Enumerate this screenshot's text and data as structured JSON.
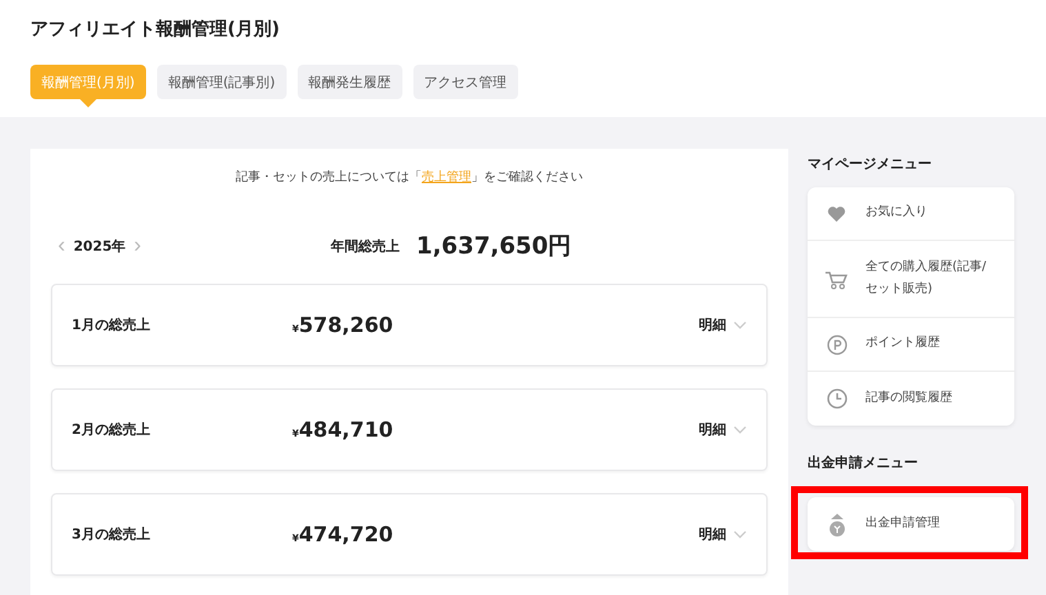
{
  "page_title": "アフィリエイト報酬管理(月別)",
  "tabs": [
    {
      "label": "報酬管理(月別)",
      "selected": true
    },
    {
      "label": "報酬管理(記事別)",
      "selected": false
    },
    {
      "label": "報酬発生履歴",
      "selected": false
    },
    {
      "label": "アクセス管理",
      "selected": false
    }
  ],
  "notice": {
    "before": "記事・セットの売上については「",
    "link": "売上管理",
    "after": "」をご確認ください"
  },
  "year_nav": {
    "prev": "‹",
    "year": "2025年",
    "next": "›"
  },
  "annual_total": {
    "label": "年間総売上",
    "value": "1,637,650円"
  },
  "months": [
    {
      "label": "1月の総売上",
      "currency": "¥",
      "amount": "578,260",
      "detail": "明細"
    },
    {
      "label": "2月の総売上",
      "currency": "¥",
      "amount": "484,710",
      "detail": "明細"
    },
    {
      "label": "3月の総売上",
      "currency": "¥",
      "amount": "474,720",
      "detail": "明細"
    }
  ],
  "mypage_menu": {
    "title": "マイページメニュー",
    "items": [
      {
        "kind": "heart",
        "label": "お気に入り"
      },
      {
        "kind": "cart",
        "label": "全ての購入履歴(記事/セット販売)"
      },
      {
        "kind": "point",
        "label": "ポイント履歴"
      },
      {
        "kind": "clock",
        "label": "記事の閲覧履歴"
      }
    ]
  },
  "withdraw_menu": {
    "title": "出金申請メニュー",
    "items": [
      {
        "kind": "coin",
        "label": "出金申請管理",
        "highlighted": true
      }
    ]
  }
}
